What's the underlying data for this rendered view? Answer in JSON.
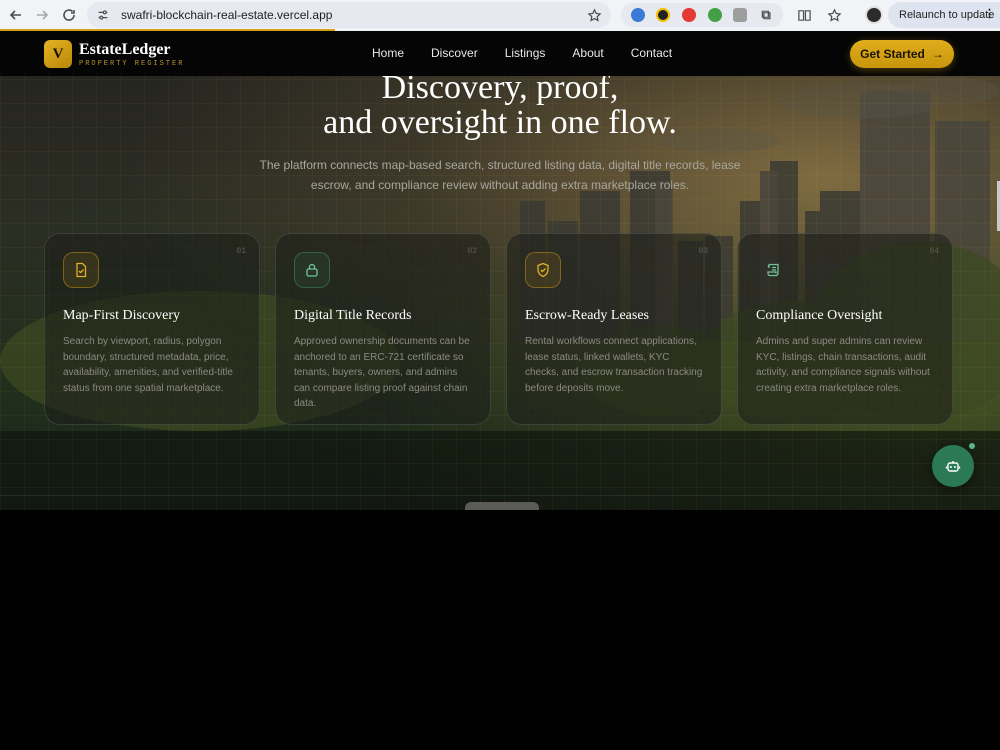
{
  "browser": {
    "url": "swafri-blockchain-real-estate.vercel.app",
    "relaunch_label": "Relaunch to update"
  },
  "header": {
    "logo_letter": "V",
    "brand_name": "EstateLedger",
    "brand_sub": "PROPERTY REGISTER",
    "nav": [
      "Home",
      "Discover",
      "Listings",
      "About",
      "Contact"
    ],
    "cta_label": "Get Started",
    "cta_arrow": "→"
  },
  "hero": {
    "line1": "Discovery, proof,",
    "line2": "and oversight in one flow.",
    "description": "The platform connects map-based search, structured listing data, digital title records, lease escrow, and compliance review without adding extra marketplace roles."
  },
  "cards": [
    {
      "num": "01",
      "icon": "document-check-icon",
      "title": "Map-First Discovery",
      "desc": "Search by viewport, radius, polygon boundary, structured metadata, price, availability, amenities, and verified-title status from one spatial marketplace."
    },
    {
      "num": "02",
      "icon": "lock-icon",
      "title": "Digital Title Records",
      "desc": "Approved ownership documents can be anchored to an ERC-721 certificate so tenants, buyers, owners, and admins can compare listing proof against chain data."
    },
    {
      "num": "03",
      "icon": "shield-check-icon",
      "title": "Escrow-Ready Leases",
      "desc": "Rental workflows connect applications, lease status, linked wallets, KYC checks, and escrow transaction tracking before deposits move."
    },
    {
      "num": "04",
      "icon": "scroll-icon",
      "title": "Compliance Oversight",
      "desc": "Admins and super admins can review KYC, listings, chain transactions, audit activity, and compliance signals without creating extra marketplace roles."
    }
  ],
  "colors": {
    "accent_gold": "#d4a017",
    "fab_green": "#2c7a55",
    "header_bg": "#050505"
  }
}
